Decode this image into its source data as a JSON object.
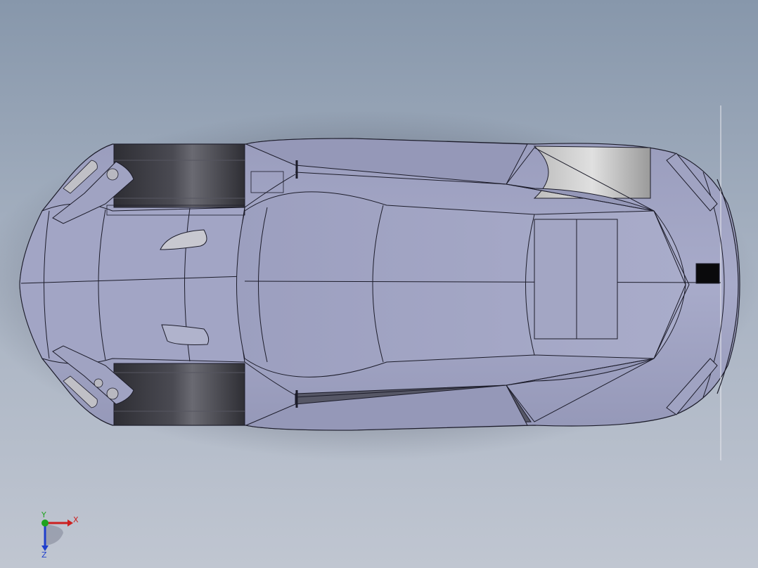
{
  "viewport": {
    "background_top": "#8797ab",
    "background_bottom": "#c0c6d1"
  },
  "model": {
    "body_color": "#a4a7c6",
    "edge_color": "#1c1c2a",
    "wheel_well_color": "#3c3c44",
    "glass_color": "#c8c8d0"
  },
  "triad": {
    "x_label": "X",
    "y_label": "Y",
    "z_label": "Z",
    "x_color": "#cc1f1f",
    "y_color": "#1fa31f",
    "z_color": "#1f3fcc"
  }
}
